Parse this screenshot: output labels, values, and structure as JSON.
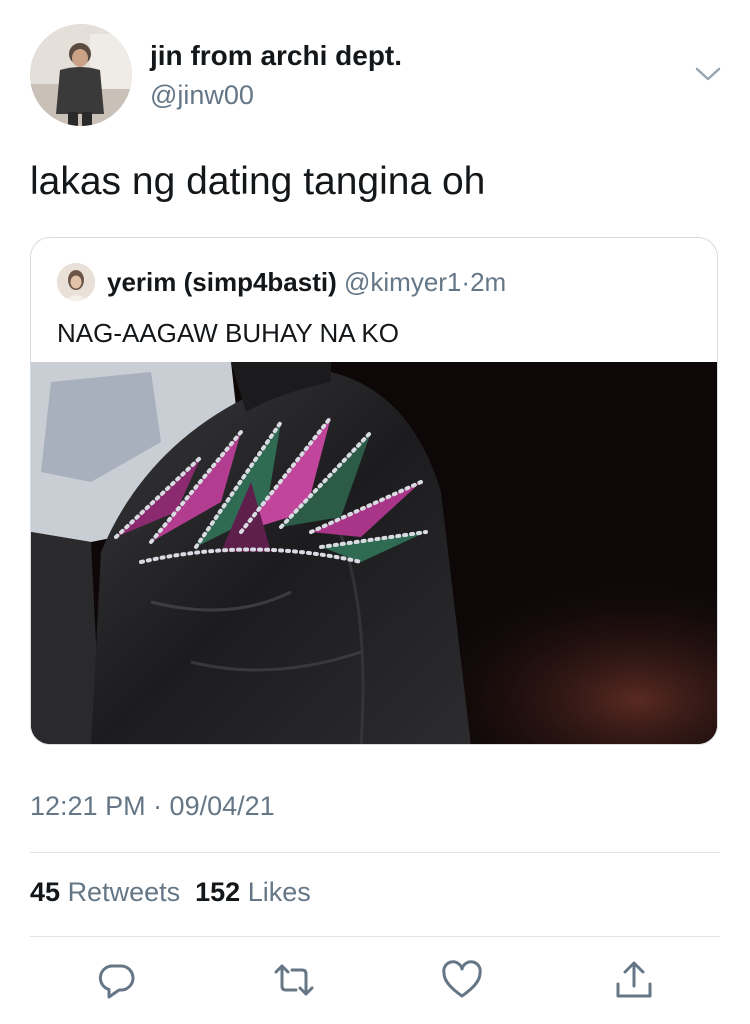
{
  "tweet": {
    "author": {
      "name": "jin from archi dept.",
      "handle": "@jinw00"
    },
    "text": "lakas ng dating tangina oh",
    "timestamp": "12:21 PM · 09/04/21"
  },
  "quoted_tweet": {
    "name": "yerim (simp4basti)",
    "handle": "@kimyer1",
    "separator": "·",
    "time": "2m",
    "text": "NAG-AAGAW BUHAY NA KO"
  },
  "stats": {
    "retweets_count": "45",
    "retweets_label": "Retweets",
    "likes_count": "152",
    "likes_label": "Likes"
  },
  "icons": {
    "menu": "chevron-down-icon",
    "reply": "reply-icon",
    "retweet": "retweet-icon",
    "like": "heart-icon",
    "share": "share-icon"
  },
  "colors": {
    "text": "#14171a",
    "secondary": "#657786",
    "border": "#d5dce2",
    "icon": "#657786"
  }
}
